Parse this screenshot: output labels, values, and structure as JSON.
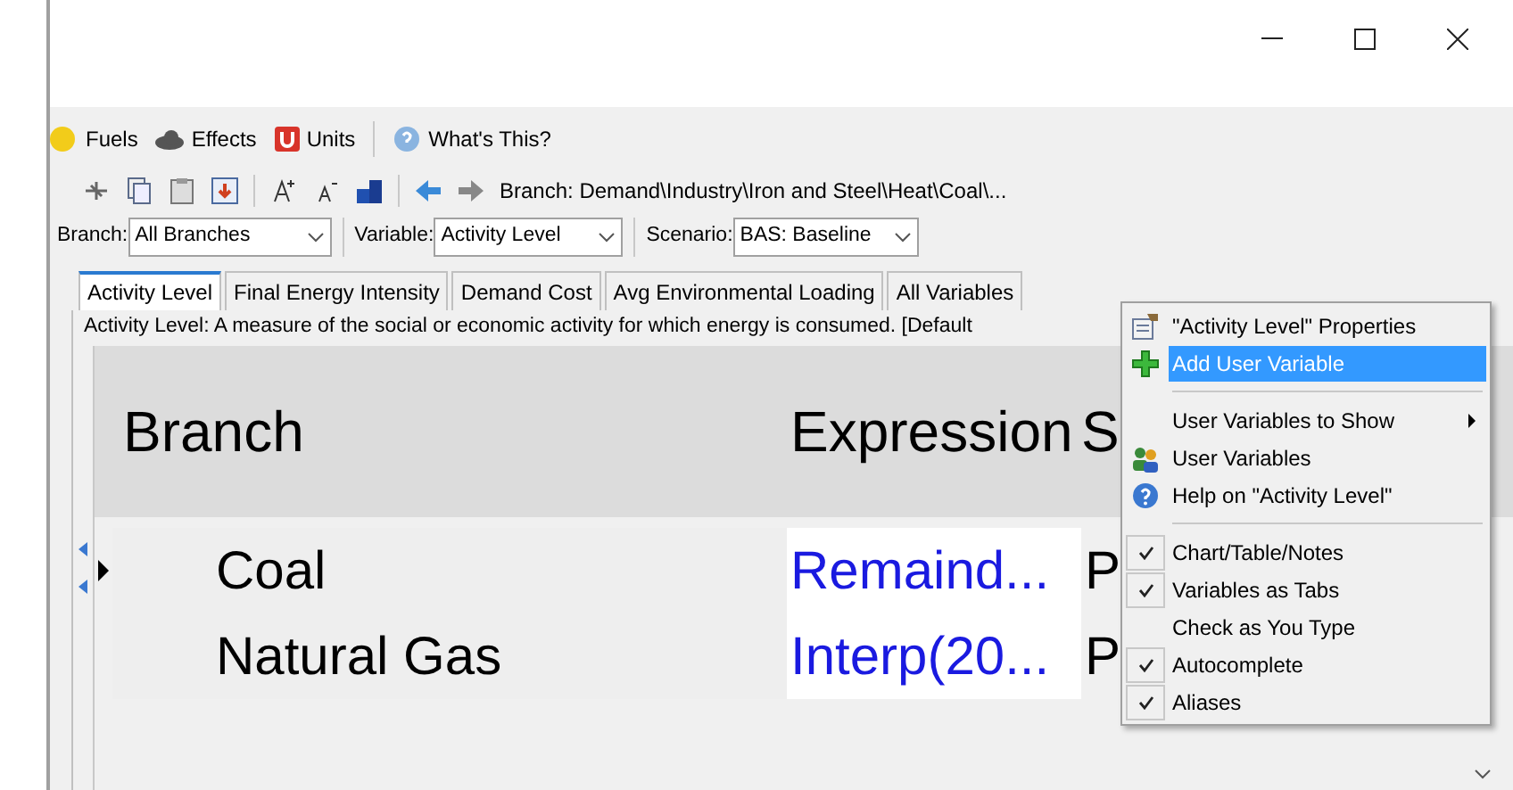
{
  "menu_bar": [
    {
      "label": "Fuels"
    },
    {
      "label": "Effects"
    },
    {
      "label": "Units"
    },
    {
      "label": "What's This?"
    }
  ],
  "breadcrumb": "Branch: Demand\\Industry\\Iron and Steel\\Heat\\Coal\\...",
  "filters": [
    {
      "label": "Branch:",
      "value": "All Branches"
    },
    {
      "label": "Variable:",
      "value": "Activity Level"
    },
    {
      "label": "Scenario:",
      "value": "BAS: Baseline"
    }
  ],
  "tabs": [
    {
      "label": "Activity Level",
      "selected": true
    },
    {
      "label": "Final Energy Intensity",
      "selected": false
    },
    {
      "label": "Demand Cost",
      "selected": false
    },
    {
      "label": "Avg Environmental Loading",
      "selected": false
    },
    {
      "label": "All Variables",
      "selected": false
    }
  ],
  "description": "Activity Level: A measure of the social or economic activity for which energy is consumed. [Default",
  "table": {
    "columns": [
      "Branch",
      "Expression",
      "S"
    ],
    "rows": [
      {
        "branch": "Coal",
        "expression": "Remaind...",
        "column_3": "P",
        "selected": true
      },
      {
        "branch": "Natural Gas",
        "expression": "Interp(20...",
        "column_3": "P",
        "selected": false
      }
    ]
  },
  "context_menu": [
    {
      "kind": "command",
      "label": "\"Activity Level\" Properties",
      "selected": false
    },
    {
      "kind": "command",
      "label": "Add User Variable",
      "selected": true
    },
    {
      "kind": "separator"
    },
    {
      "kind": "submenu",
      "label": "User Variables to Show",
      "selected": false
    },
    {
      "kind": "command",
      "label": "User Variables",
      "selected": false
    },
    {
      "kind": "command",
      "label": "Help on \"Activity Level\"",
      "selected": false
    },
    {
      "kind": "separator"
    },
    {
      "kind": "toggle",
      "label": "Chart/Table/Notes",
      "checked": true,
      "selected": false
    },
    {
      "kind": "toggle",
      "label": "Variables as Tabs",
      "checked": true,
      "selected": false
    },
    {
      "kind": "toggle",
      "label": "Check as You Type",
      "checked": false,
      "selected": false
    },
    {
      "kind": "toggle",
      "label": "Autocomplete",
      "checked": true,
      "selected": false
    },
    {
      "kind": "toggle",
      "label": "Aliases",
      "checked": true,
      "selected": false
    }
  ]
}
